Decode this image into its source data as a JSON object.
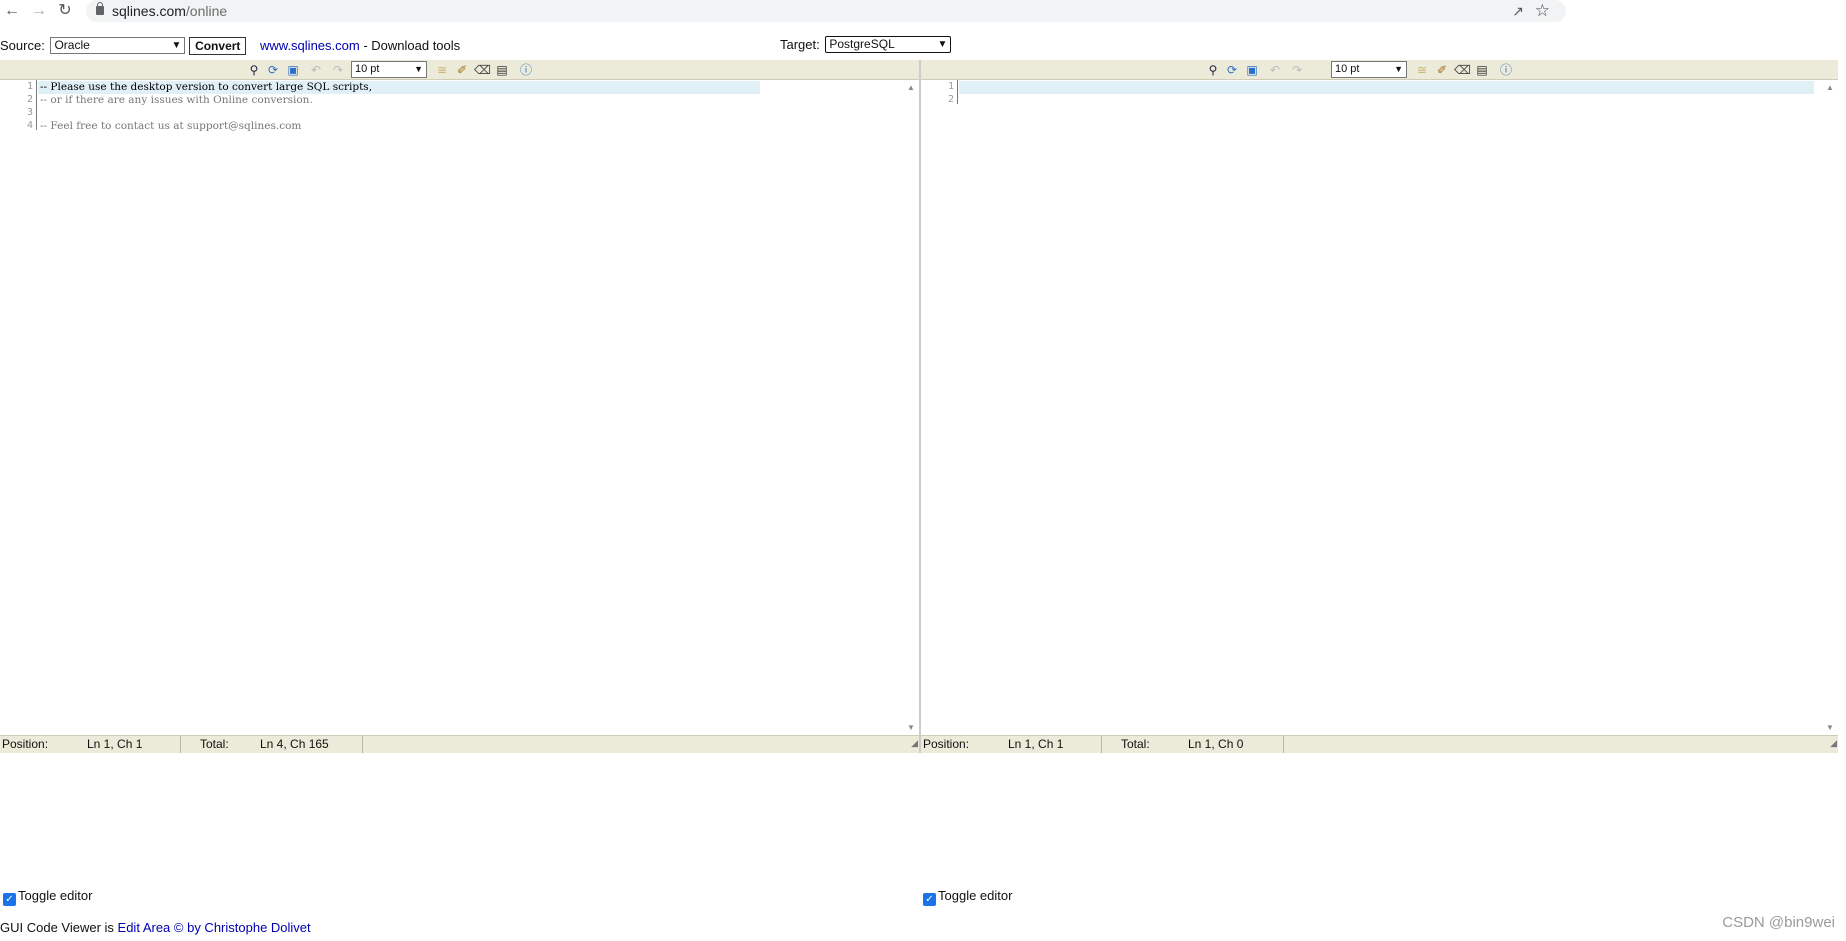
{
  "browser": {
    "url_host": "sqlines.com",
    "url_path": "/online",
    "back_icon": "arrow-left-icon",
    "forward_icon": "arrow-right-icon",
    "reload_icon": "reload-icon"
  },
  "toolbar_top": {
    "source_label": "Source:",
    "source_value": "Oracle",
    "convert_label": "Convert",
    "site_link": "www.sqlines.com",
    "site_sep": " - ",
    "download_label": "Download tools",
    "target_label": "Target:",
    "target_value": "PostgreSQL"
  },
  "source_editor": {
    "font_size": "10 pt",
    "lines": [
      "-- Please use the desktop version to convert large SQL scripts,",
      "-- or if there are any issues with Online conversion.",
      "",
      "-- Feel free to contact us at support@sqlines.com"
    ],
    "line_numbers": [
      "1",
      "2",
      "3",
      "4"
    ],
    "position_label": "Position:",
    "position_value": "Ln 1, Ch 1",
    "total_label": "Total:",
    "total_value": "Ln 4, Ch 165",
    "toggle_label": "Toggle editor"
  },
  "target_editor": {
    "font_size": "10 pt",
    "line_numbers": [
      "1",
      "2"
    ],
    "position_label": "Position:",
    "position_value": "Ln 1, Ch 1",
    "total_label": "Total:",
    "total_value": "Ln 1, Ch 0",
    "toggle_label": "Toggle editor"
  },
  "footer": {
    "prefix": "GUI Code Viewer is ",
    "link": "Edit Area © by Christophe Dolivet"
  },
  "watermark": "CSDN @bin9wei"
}
